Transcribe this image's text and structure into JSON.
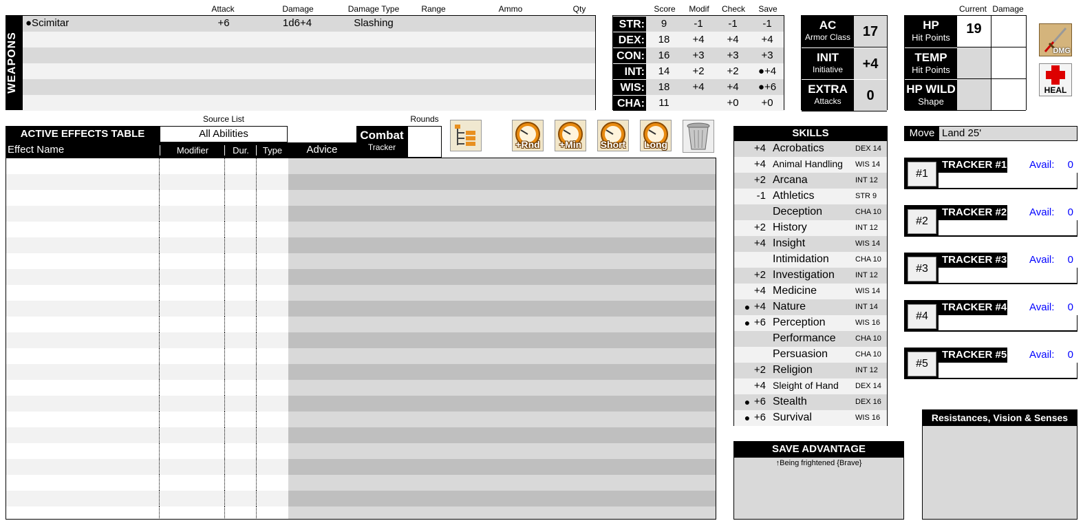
{
  "weapons": {
    "section_label": "WEAPONS",
    "headers": {
      "attack": "Attack",
      "damage": "Damage",
      "damage_type": "Damage Type",
      "range": "Range",
      "ammo": "Ammo",
      "qty": "Qty"
    },
    "rows": [
      {
        "name": "●Scimitar",
        "attack": "+6",
        "damage": "1d6+4",
        "damage_type": "Slashing",
        "range": "",
        "ammo": "",
        "qty": ""
      },
      {
        "name": "",
        "attack": "",
        "damage": "",
        "damage_type": "",
        "range": "",
        "ammo": "",
        "qty": ""
      },
      {
        "name": "",
        "attack": "",
        "damage": "",
        "damage_type": "",
        "range": "",
        "ammo": "",
        "qty": ""
      },
      {
        "name": "",
        "attack": "",
        "damage": "",
        "damage_type": "",
        "range": "",
        "ammo": "",
        "qty": ""
      },
      {
        "name": "",
        "attack": "",
        "damage": "",
        "damage_type": "",
        "range": "",
        "ammo": "",
        "qty": ""
      },
      {
        "name": "",
        "attack": "",
        "damage": "",
        "damage_type": "",
        "range": "",
        "ammo": "",
        "qty": ""
      }
    ]
  },
  "abilities": {
    "headers": {
      "score": "Score",
      "modif": "Modif",
      "check": "Check",
      "save": "Save"
    },
    "rows": [
      {
        "name": "STR:",
        "score": "9",
        "modif": "-1",
        "check": "-1",
        "save": "-1"
      },
      {
        "name": "DEX:",
        "score": "18",
        "modif": "+4",
        "check": "+4",
        "save": "+4"
      },
      {
        "name": "CON:",
        "score": "16",
        "modif": "+3",
        "check": "+3",
        "save": "+3"
      },
      {
        "name": "INT:",
        "score": "14",
        "modif": "+2",
        "check": "+2",
        "save": "●+4"
      },
      {
        "name": "WIS:",
        "score": "18",
        "modif": "+4",
        "check": "+4",
        "save": "●+6"
      },
      {
        "name": "CHA:",
        "score": "11",
        "modif": "",
        "check": "+0",
        "save": "+0"
      }
    ]
  },
  "combat_stats": [
    {
      "title": "AC",
      "sub": "Armor Class",
      "value": "17"
    },
    {
      "title": "INIT",
      "sub": "Initiative",
      "value": "+4"
    },
    {
      "title": "EXTRA",
      "sub": "Attacks",
      "value": "0"
    }
  ],
  "hp": {
    "headers": {
      "current": "Current",
      "damage": "Damage"
    },
    "rows": [
      {
        "title": "HP",
        "sub": "Hit Points",
        "current": "19",
        "damage": ""
      },
      {
        "title": "TEMP",
        "sub": "Hit Points",
        "current": "",
        "damage": ""
      },
      {
        "title": "HP WILD",
        "sub": "Shape",
        "current": "",
        "damage": ""
      }
    ],
    "dmg_button": "DMG",
    "heal_button": "HEAL"
  },
  "effects": {
    "source_list_label": "Source List",
    "source_list_value": "All Abilities",
    "title": "ACTIVE EFFECTS TABLE",
    "col_effect": "Effect Name",
    "col_modifier": "Modifier",
    "col_dur": "Dur.",
    "col_type": "Type",
    "col_advice": "Advice",
    "combat_tracker_title": "Combat",
    "combat_tracker_sub": "Tracker",
    "rounds_label": "Rounds",
    "rounds_value": "",
    "buttons": {
      "rnd": "+Rnd",
      "min": "+Min",
      "short": "Short",
      "long": "Long"
    }
  },
  "skills": {
    "title": "SKILLS",
    "rows": [
      {
        "prof": "",
        "bonus": "+4",
        "name": "Acrobatics",
        "attr": "DEX 14"
      },
      {
        "prof": "",
        "bonus": "+4",
        "name": "Animal Handling",
        "attr": "WIS 14"
      },
      {
        "prof": "",
        "bonus": "+2",
        "name": "Arcana",
        "attr": "INT 12"
      },
      {
        "prof": "",
        "bonus": "-1",
        "name": "Athletics",
        "attr": "STR 9"
      },
      {
        "prof": "",
        "bonus": "",
        "name": "Deception",
        "attr": "CHA 10"
      },
      {
        "prof": "",
        "bonus": "+2",
        "name": "History",
        "attr": "INT 12"
      },
      {
        "prof": "",
        "bonus": "+4",
        "name": "Insight",
        "attr": "WIS 14"
      },
      {
        "prof": "",
        "bonus": "",
        "name": "Intimidation",
        "attr": "CHA 10"
      },
      {
        "prof": "",
        "bonus": "+2",
        "name": "Investigation",
        "attr": "INT 12"
      },
      {
        "prof": "",
        "bonus": "+4",
        "name": "Medicine",
        "attr": "WIS 14"
      },
      {
        "prof": "●",
        "bonus": "+4",
        "name": "Nature",
        "attr": "INT 14"
      },
      {
        "prof": "●",
        "bonus": "+6",
        "name": "Perception",
        "attr": "WIS 16"
      },
      {
        "prof": "",
        "bonus": "",
        "name": "Performance",
        "attr": "CHA 10"
      },
      {
        "prof": "",
        "bonus": "",
        "name": "Persuasion",
        "attr": "CHA 10"
      },
      {
        "prof": "",
        "bonus": "+2",
        "name": "Religion",
        "attr": "INT 12"
      },
      {
        "prof": "",
        "bonus": "+4",
        "name": "Sleight of Hand",
        "attr": "DEX 14"
      },
      {
        "prof": "●",
        "bonus": "+6",
        "name": "Stealth",
        "attr": "DEX 16"
      },
      {
        "prof": "●",
        "bonus": "+6",
        "name": "Survival",
        "attr": "WIS 16"
      }
    ]
  },
  "move": {
    "label": "Move",
    "value": "Land 25'"
  },
  "trackers": [
    {
      "num": "#1",
      "title": "TRACKER #1",
      "avail_label": "Avail:",
      "avail_value": "0"
    },
    {
      "num": "#2",
      "title": "TRACKER #2",
      "avail_label": "Avail:",
      "avail_value": "0"
    },
    {
      "num": "#3",
      "title": "TRACKER #3",
      "avail_label": "Avail:",
      "avail_value": "0"
    },
    {
      "num": "#4",
      "title": "TRACKER #4",
      "avail_label": "Avail:",
      "avail_value": "0"
    },
    {
      "num": "#5",
      "title": "TRACKER #5",
      "avail_label": "Avail:",
      "avail_value": "0"
    }
  ],
  "save_advantage": {
    "title": "SAVE ADVANTAGE",
    "text": "↑Being frightened {Brave}"
  },
  "resistances": {
    "title": "Resistances, Vision & Senses"
  },
  "colors": {
    "accent_blue": "#0000ff",
    "header_black": "#000000",
    "row_gray": "#d9d9d9",
    "row_light": "#f2f2f2",
    "advice_gray": "#d0d0d0"
  }
}
